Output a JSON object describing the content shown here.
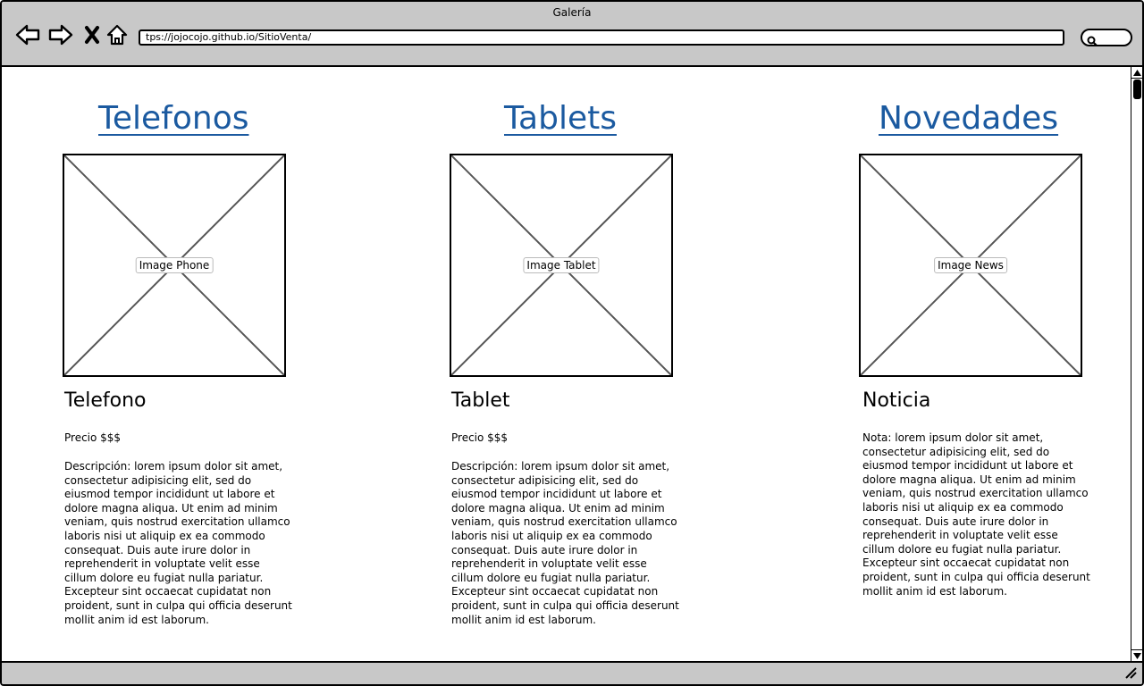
{
  "window": {
    "title": "Galería"
  },
  "toolbar": {
    "back_icon": "back-arrow-icon",
    "forward_icon": "forward-arrow-icon",
    "close_icon": "close-icon",
    "home_icon": "home-icon",
    "url": "tps://jojocojo.github.io/SitioVenta/",
    "search_icon": "search-icon"
  },
  "colors": {
    "link": "#1b5aa0",
    "chrome": "#c8c8c8"
  },
  "columns": [
    {
      "title": "Telefonos",
      "image_label": "Image Phone",
      "item_name": "Telefono",
      "price": "Precio $$$",
      "text": "Descripción: lorem ipsum dolor sit amet, consectetur adipisicing elit, sed do eiusmod tempor incididunt ut labore et dolore magna aliqua. Ut enim ad minim veniam, quis nostrud exercitation ullamco laboris nisi ut aliquip ex ea commodo consequat. Duis aute irure dolor in reprehenderit in voluptate velit esse cillum dolore eu fugiat nulla pariatur. Excepteur sint occaecat cupidatat non proident, sunt in culpa qui officia deserunt mollit anim id est laborum."
    },
    {
      "title": "Tablets",
      "image_label": "Image Tablet",
      "item_name": "Tablet",
      "price": "Precio $$$",
      "text": "Descripción: lorem ipsum dolor sit amet, consectetur adipisicing elit, sed do eiusmod tempor incididunt ut labore et dolore magna aliqua. Ut enim ad minim veniam, quis nostrud exercitation ullamco laboris nisi ut aliquip ex ea commodo consequat. Duis aute irure dolor in reprehenderit in voluptate velit esse cillum dolore eu fugiat nulla pariatur. Excepteur sint occaecat cupidatat non proident, sunt in culpa qui officia deserunt mollit anim id est laborum."
    },
    {
      "title": "Novedades",
      "image_label": "Image News",
      "item_name": "Noticia",
      "price": "",
      "text": "Nota: lorem ipsum dolor sit amet, consectetur adipisicing elit, sed do eiusmod tempor incididunt ut labore et dolore magna aliqua. Ut enim ad minim veniam, quis nostrud exercitation ullamco laboris nisi ut aliquip ex ea commodo consequat. Duis aute irure dolor in reprehenderit in voluptate velit esse cillum dolore eu fugiat nulla pariatur. Excepteur sint occaecat cupidatat non proident, sunt in culpa qui officia deserunt mollit anim id est laborum."
    }
  ]
}
